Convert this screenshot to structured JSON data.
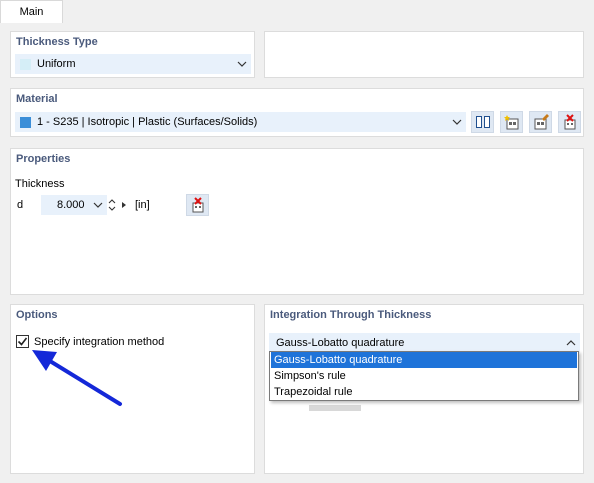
{
  "tabs": [
    {
      "label": "Main"
    }
  ],
  "thickness_type": {
    "title": "Thickness Type",
    "selected": "Uniform",
    "swatch_color": "#d5eef7"
  },
  "material": {
    "title": "Material",
    "selected": "1 - S235 | Isotropic | Plastic (Surfaces/Solids)",
    "swatch_color": "#3b8ed8",
    "buttons": [
      "library-icon",
      "new-material-icon",
      "edit-material-icon",
      "delete-material-icon"
    ]
  },
  "properties": {
    "title": "Properties",
    "thickness_label": "Thickness",
    "symbol": "d",
    "value": "8.000",
    "unit": "[in]"
  },
  "options": {
    "title": "Options",
    "specify_integration_label": "Specify integration method",
    "specify_integration_checked": true
  },
  "integration": {
    "title": "Integration Through Thickness",
    "selected": "Gauss-Lobatto quadrature",
    "options": [
      "Gauss-Lobatto quadrature",
      "Simpson's rule",
      "Trapezoidal rule"
    ]
  },
  "colors": {
    "section_title": "#4a5a7c",
    "combo_bg": "#e8f1fb",
    "selection": "#1e73d9",
    "arrow": "#1428d8"
  }
}
